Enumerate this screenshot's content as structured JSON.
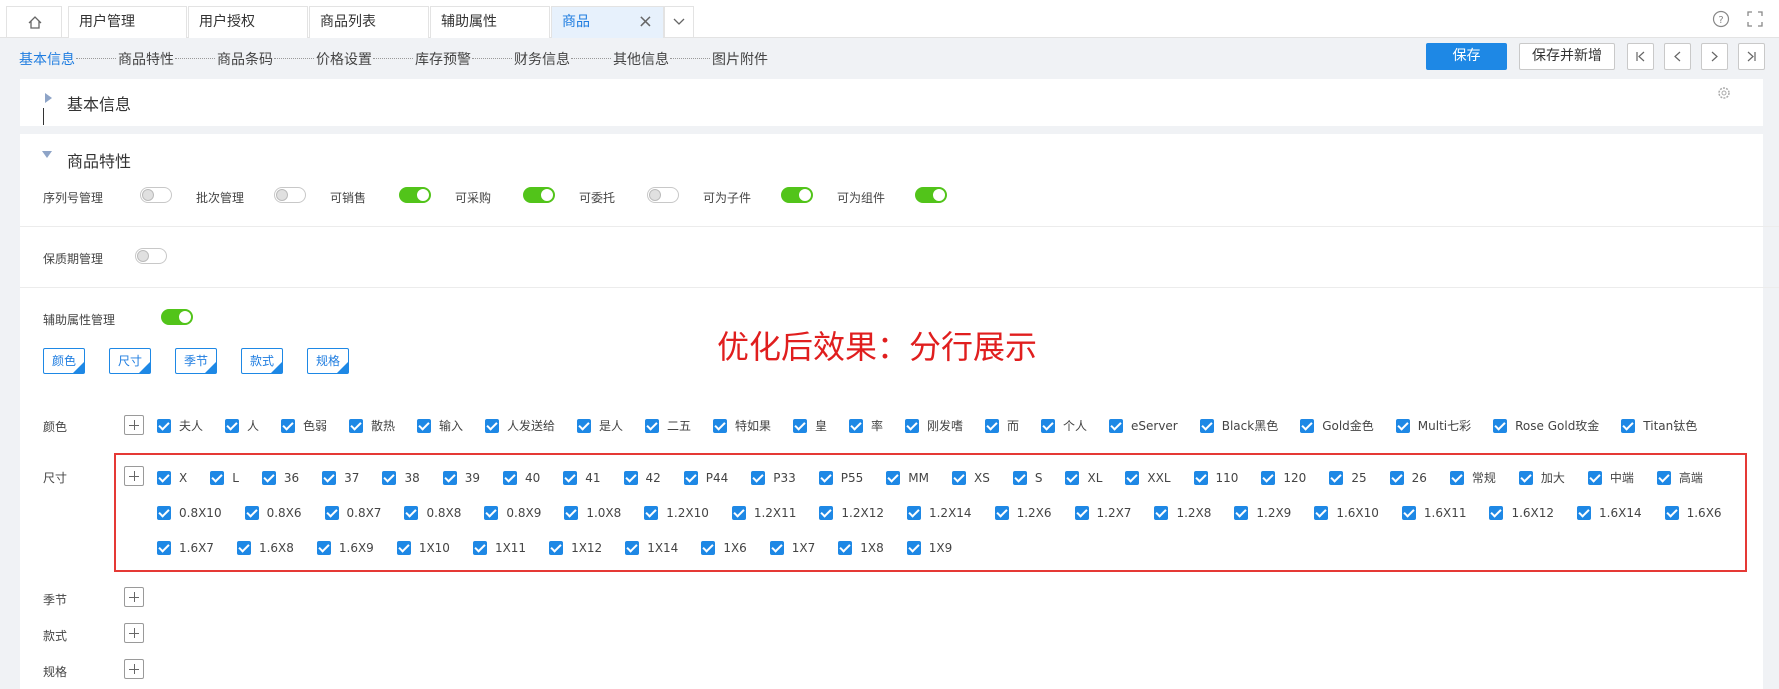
{
  "tabs": [
    {
      "label": "用户管理",
      "active": false
    },
    {
      "label": "用户授权",
      "active": false
    },
    {
      "label": "商品列表",
      "active": false
    },
    {
      "label": "辅助属性",
      "active": false
    },
    {
      "label": "商品",
      "active": true
    }
  ],
  "icons": {
    "home": "home-icon",
    "close": "close-icon",
    "dropdown": "chevron-down-icon",
    "help": "help-icon",
    "fullscreen": "fullscreen-icon",
    "settings": "gear-icon"
  },
  "steps": [
    "基本信息",
    "商品特性",
    "商品条码",
    "价格设置",
    "库存预警",
    "财务信息",
    "其他信息",
    "图片附件"
  ],
  "active_step": "基本信息",
  "toolbar": {
    "save": "保存",
    "save_new": "保存并新增"
  },
  "basic_panel": {
    "title": "基本信息"
  },
  "feature_panel": {
    "title": "商品特性",
    "switches": [
      {
        "label": "序列号管理",
        "on": false
      },
      {
        "label": "批次管理",
        "on": false
      },
      {
        "label": "可销售",
        "on": true
      },
      {
        "label": "可采购",
        "on": true
      },
      {
        "label": "可委托",
        "on": false
      },
      {
        "label": "可为子件",
        "on": true
      },
      {
        "label": "可为组件",
        "on": true
      }
    ],
    "shelf_life": {
      "label": "保质期管理",
      "on": false
    },
    "aux_mgmt": {
      "label": "辅助属性管理",
      "on": true
    },
    "attr_buttons": [
      "颜色",
      "尺寸",
      "季节",
      "款式",
      "规格"
    ]
  },
  "annotation": "优化后效果：分行展示",
  "attributes": {
    "color": {
      "label": "颜色",
      "values": [
        "夫人",
        "人",
        "色弱",
        "散热",
        "输入",
        "人发送给",
        "是人",
        "二五",
        "特如果",
        "皇",
        "率",
        "刚发嗜",
        "而",
        "个人",
        "eServer",
        "Black黑色",
        "Gold金色",
        "Multi七彩",
        "Rose Gold玫金",
        "Titan钛色"
      ]
    },
    "size": {
      "label": "尺寸",
      "values": [
        "X",
        "L",
        "36",
        "37",
        "38",
        "39",
        "40",
        "41",
        "42",
        "P44",
        "P33",
        "P55",
        "MM",
        "XS",
        "S",
        "XL",
        "XXL",
        "110",
        "120",
        "25",
        "26",
        "常规",
        "加大",
        "中端",
        "高端",
        "0.8X10",
        "0.8X6",
        "0.8X7",
        "0.8X8",
        "0.8X9",
        "1.0X8",
        "1.2X10",
        "1.2X11",
        "1.2X12",
        "1.2X14",
        "1.2X6",
        "1.2X7",
        "1.2X8",
        "1.2X9",
        "1.6X10",
        "1.6X11",
        "1.6X12",
        "1.6X14",
        "1.6X6",
        "1.6X7",
        "1.6X8",
        "1.6X9",
        "1X10",
        "1X11",
        "1X12",
        "1X14",
        "1X6",
        "1X7",
        "1X8",
        "1X9"
      ]
    },
    "season": {
      "label": "季节"
    },
    "style": {
      "label": "款式"
    },
    "spec": {
      "label": "规格"
    }
  }
}
